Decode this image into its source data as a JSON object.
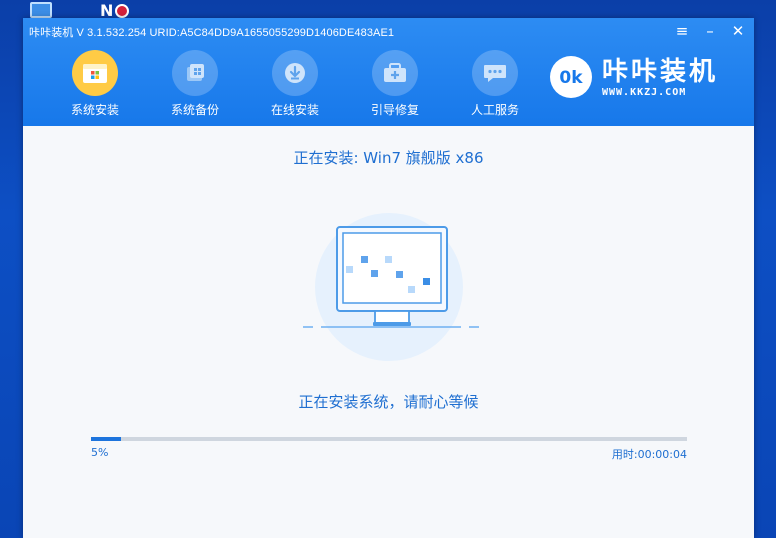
{
  "window": {
    "title": "咔咔装机 V 3.1.532.254 URID:A5C84DD9A1655055299D1406DE483AE1",
    "controls": {
      "menu": "≡",
      "minimize": "–",
      "close": "✕"
    }
  },
  "nav": {
    "items": [
      {
        "label": "系统安装",
        "icon": "windows-system-install-icon"
      },
      {
        "label": "系统备份",
        "icon": "backup-stack-icon"
      },
      {
        "label": "在线安装",
        "icon": "download-icon"
      },
      {
        "label": "引导修复",
        "icon": "toolbox-icon"
      },
      {
        "label": "人工服务",
        "icon": "chat-bubble-icon"
      }
    ],
    "active_index": 0
  },
  "brand": {
    "name": "咔咔装机",
    "url": "WWW.KKZJ.COM"
  },
  "install": {
    "title": "正在安装: Win7 旗舰版 x86",
    "status": "正在安装系统，请耐心等候",
    "progress_percent": 5,
    "progress_label": "5%",
    "elapsed": "用时:00:00:04"
  },
  "colors": {
    "header_blue": "#1778ea",
    "accent_blue": "#1f6fd1",
    "active_nav": "#ffcb45",
    "desktop_blue": "#0d4fc4"
  }
}
